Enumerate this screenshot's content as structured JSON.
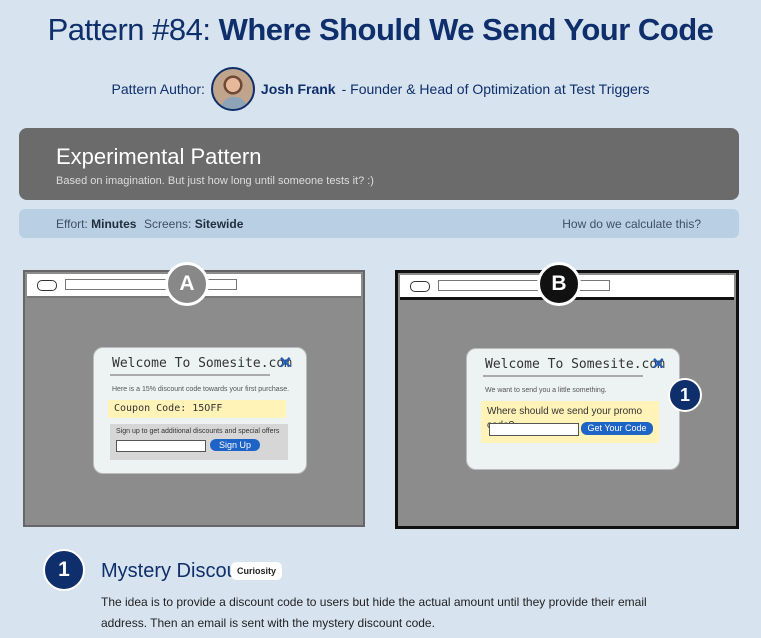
{
  "header": {
    "title_prefix": "Pattern #84:",
    "title_name": "Where Should We Send Your Code"
  },
  "author": {
    "label": "Pattern Author:",
    "name": "Josh Frank",
    "role": "- Founder & Head of Optimization at Test Triggers"
  },
  "banner": {
    "title": "Experimental Pattern",
    "subtitle": "Based on imagination. But just how long until someone tests it? :)"
  },
  "meta": {
    "effort_label": "Effort:",
    "effort_value": "Minutes",
    "screens_label": "Screens:",
    "screens_value": "Sitewide",
    "calc_link": "How do we calculate this?"
  },
  "variant_a": {
    "label": "A",
    "popup_title": "Welcome To Somesite.com",
    "text": "Here is a 15% discount code towards your first purchase.",
    "coupon": "Coupon Code: 15OFF",
    "signup_text": "Sign up to get additional discounts and special offers",
    "button": "Sign Up"
  },
  "variant_b": {
    "label": "B",
    "popup_title": "Welcome To Somesite.com",
    "text": "We want to send you a little something.",
    "question": "Where should we send your promo code?",
    "button": "Get Your Code",
    "marker": "1"
  },
  "change": {
    "number": "1",
    "title": "Mystery Discount",
    "tag": "Curiosity",
    "description": "The idea is to provide a discount code to users but hide the actual amount until they provide their email address. Then an email is sent with the mystery discount code."
  }
}
